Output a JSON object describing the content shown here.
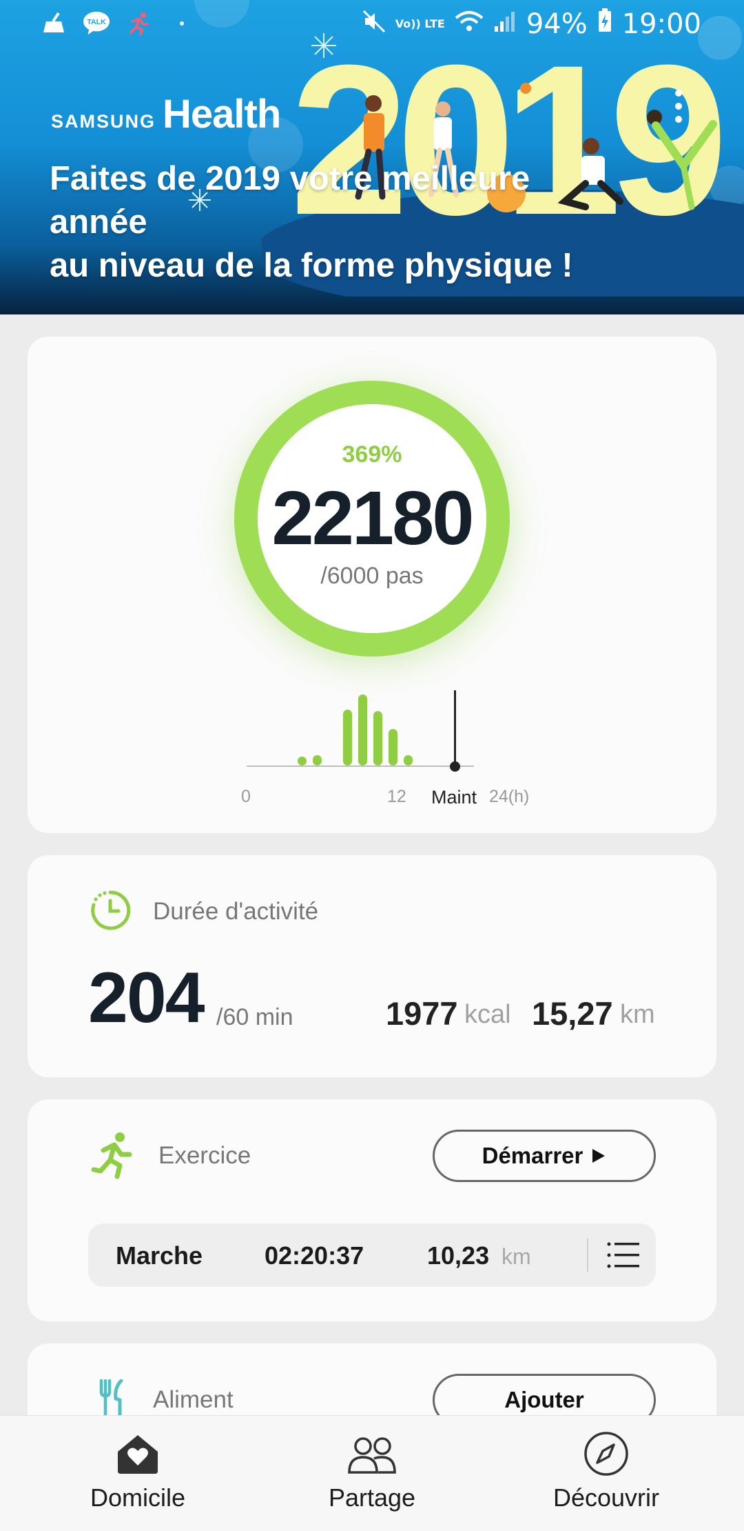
{
  "status_bar": {
    "notifications": [
      "clean-icon",
      "talk-icon",
      "run-notif-icon"
    ],
    "talk_text": "TALK",
    "volte": "Vo)) LTE",
    "battery": "94%",
    "time": "19:00"
  },
  "header": {
    "brand_samsung": "SAMSUNG",
    "brand_health": "Health",
    "promo_line1": "Faites de 2019 votre meilleure",
    "promo_line2": "année",
    "promo_line3": "au niveau de la forme physique !",
    "art_year": "2019"
  },
  "steps": {
    "percent": "369%",
    "count": "22180",
    "goal": "/6000 pas",
    "progress_fraction": 1.0,
    "hourly_chart": {
      "bars_relative": [
        0.12,
        0.14,
        0.0,
        0.74,
        0.94,
        0.72,
        0.48,
        0.14
      ],
      "labels": {
        "start": "0",
        "mid": "12",
        "now": "Maint",
        "end": "24(h)"
      }
    }
  },
  "activity": {
    "title": "Durée d'activité",
    "value": "204",
    "goal": "/60 min",
    "kcal_value": "1977",
    "kcal_unit": "kcal",
    "distance_value": "15,27",
    "distance_unit": "km"
  },
  "exercise": {
    "title": "Exercice",
    "start_button": "Démarrer",
    "last": {
      "type": "Marche",
      "duration": "02:20:37",
      "distance_value": "10,23",
      "distance_unit": "km"
    }
  },
  "food": {
    "title": "Aliment",
    "add_button": "Ajouter"
  },
  "nav": {
    "home": "Domicile",
    "share": "Partage",
    "discover": "Découvrir"
  },
  "colors": {
    "accent_green": "#9fdd55",
    "header_blue": "#1ea2e2",
    "food_teal": "#4fc1c5"
  }
}
